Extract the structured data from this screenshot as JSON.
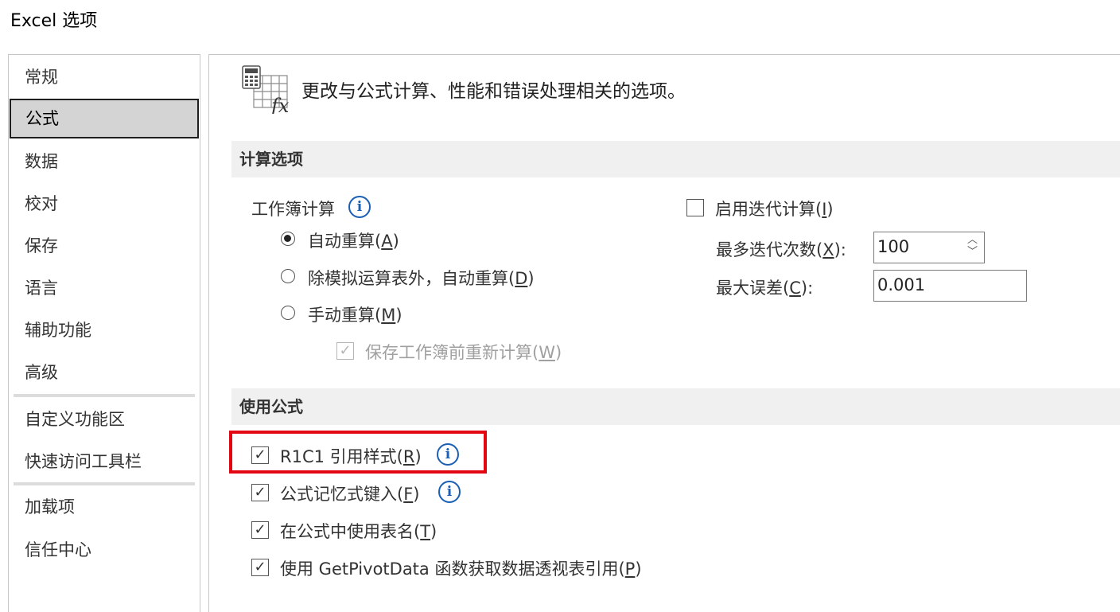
{
  "window": {
    "title": "Excel 选项"
  },
  "sidebar": {
    "items": [
      {
        "label": "常规"
      },
      {
        "label": "公式",
        "active": true
      },
      {
        "label": "数据"
      },
      {
        "label": "校对"
      },
      {
        "label": "保存"
      },
      {
        "label": "语言"
      },
      {
        "label": "辅助功能"
      },
      {
        "label": "高级"
      },
      {
        "label": "自定义功能区"
      },
      {
        "label": "快速访问工具栏"
      },
      {
        "label": "加载项"
      },
      {
        "label": "信任中心"
      }
    ]
  },
  "main": {
    "header": {
      "text": "更改与公式计算、性能和错误处理相关的选项。",
      "icon": "formula-calculator-icon"
    },
    "calc_section": {
      "title": "计算选项",
      "workbook_calc_label": "工作簿计算",
      "radios": [
        {
          "label": "自动重算(",
          "key": "A",
          "after": ")",
          "selected": true
        },
        {
          "label": "除模拟运算表外，自动重算(",
          "key": "D",
          "after": ")",
          "selected": false
        },
        {
          "label": "手动重算(",
          "key": "M",
          "after": ")",
          "selected": false
        }
      ],
      "recalc_before_save": {
        "label": "保存工作簿前重新计算(",
        "key": "W",
        "after": ")",
        "checked": true,
        "disabled": true
      },
      "iterative": {
        "label": "启用迭代计算(",
        "key": "I",
        "after": ")",
        "checked": false
      },
      "max_iterations": {
        "label": "最多迭代次数(",
        "key": "X",
        "after": "):",
        "value": "100"
      },
      "max_change": {
        "label": "最大误差(",
        "key": "C",
        "after": "):",
        "value": "0.001"
      }
    },
    "formulas_section": {
      "title": "使用公式",
      "options": [
        {
          "label": "R1C1 引用样式(",
          "key": "R",
          "after": ")",
          "checked": true
        },
        {
          "label": "公式记忆式键入(",
          "key": "F",
          "after": ")",
          "checked": true
        },
        {
          "label": "在公式中使用表名(",
          "key": "T",
          "after": ")",
          "checked": true
        },
        {
          "label": "使用 GetPivotData 函数获取数据透视表引用(",
          "key": "P",
          "after": ")",
          "checked": true
        }
      ]
    }
  },
  "colors": {
    "highlight": "#e30613",
    "info": "#1a5fb4",
    "section_bg": "#f0f0f0"
  },
  "glyphs": {
    "check": "✓",
    "info": "i",
    "spin_up": "︿",
    "spin_down": "﹀"
  }
}
